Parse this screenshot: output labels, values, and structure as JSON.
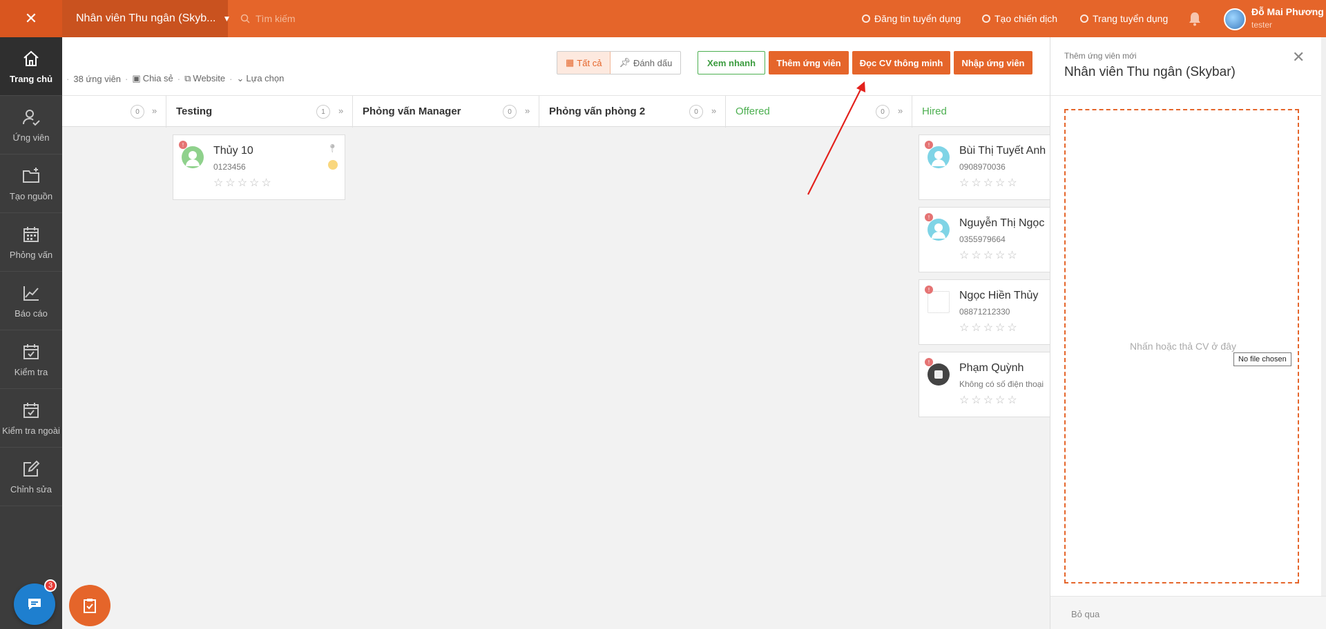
{
  "topbar": {
    "job_title": "Nhân viên Thu ngân (Skyb...",
    "search_placeholder": "Tìm kiếm",
    "menu": [
      "Đăng tin tuyển dụng",
      "Tạo chiến dịch",
      "Trang tuyển dụng"
    ],
    "user_name": "Đỗ Mai Phương",
    "user_role": "tester"
  },
  "sidebar": {
    "items": [
      {
        "label": "Trang chủ",
        "icon": "home-icon"
      },
      {
        "label": "Ứng viên",
        "icon": "user-check-icon"
      },
      {
        "label": "Tạo nguồn",
        "icon": "folder-plus-icon"
      },
      {
        "label": "Phỏng vấn",
        "icon": "calendar-grid-icon"
      },
      {
        "label": "Báo cáo",
        "icon": "line-chart-icon"
      },
      {
        "label": "Kiểm tra",
        "icon": "calendar-check-icon"
      },
      {
        "label": "Kiểm tra ngoài",
        "icon": "calendar-check-icon"
      },
      {
        "label": "Chỉnh sửa",
        "icon": "edit-icon"
      }
    ],
    "chat_badge": "3"
  },
  "toolbar": {
    "candidate_count": "38 ứng viên",
    "share": "Chia sẻ",
    "website": "Website",
    "options": "Lựa chọn",
    "filter_all": "Tất cả",
    "filter_marked": "Đánh dấu",
    "quick_view": "Xem nhanh",
    "add_candidate": "Thêm ứng viên",
    "smart_cv": "Đọc CV thông minh",
    "import": "Nhập ứng viên"
  },
  "stages": [
    {
      "name": "",
      "count": "0"
    },
    {
      "name": "Testing",
      "count": "1"
    },
    {
      "name": "Phỏng vấn Manager",
      "count": "0"
    },
    {
      "name": "Phỏng vấn phòng 2",
      "count": "0"
    },
    {
      "name": "Offered",
      "count": "0"
    },
    {
      "name": "Hired",
      "count": ""
    }
  ],
  "cards": [
    {
      "name": "Thủy 10",
      "phone": "0123456",
      "stars": "☆☆☆☆☆"
    },
    {
      "name": "Bùi Thị Tuyết Anh",
      "phone": "0908970036",
      "stars": "☆☆☆☆☆"
    },
    {
      "name": "Nguyễn Thị Ngọc",
      "phone": "0355979664",
      "stars": "☆☆☆☆☆"
    },
    {
      "name": "Ngọc Hiền Thủy",
      "phone": "08871212330",
      "stars": "☆☆☆☆☆"
    },
    {
      "name": "Phạm Quỳnh",
      "phone": "Không có số điện thoại",
      "stars": "☆☆☆☆☆"
    }
  ],
  "panel": {
    "subtitle": "Thêm ứng viên mới",
    "title": "Nhân viên Thu ngân (Skybar)",
    "drop_hint": "Nhấn hoặc thả CV ở đây",
    "file_tooltip": "No file chosen",
    "skip": "Bỏ qua"
  },
  "colors": {
    "brand": "#e5652a",
    "sidebar": "#3c3c3c",
    "green": "#4caf50",
    "annotation_arrow": "#e3211c"
  }
}
